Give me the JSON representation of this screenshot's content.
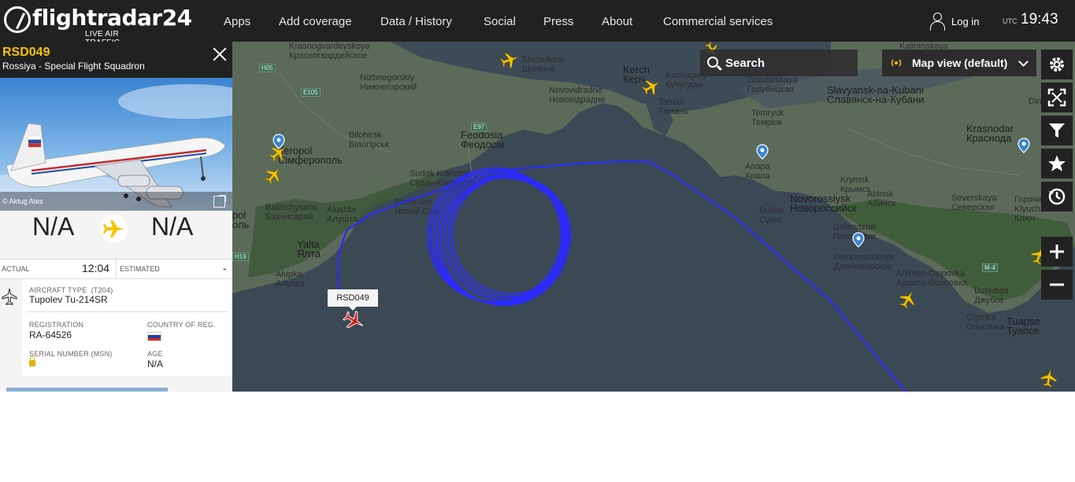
{
  "app": {
    "logo_text": "flightradar24",
    "logo_sub": "LIVE AIR TRAFFIC"
  },
  "nav": {
    "items": [
      "Apps",
      "Add coverage",
      "Data / History",
      "Social",
      "Press",
      "About",
      "Commercial services"
    ],
    "login": "Log in",
    "utc_label": "UTC",
    "clock": "19:43"
  },
  "flight": {
    "callsign": "RSD049",
    "airline": "Rossiya - Special Flight Squadron",
    "photo_credit": "© Aktug Ates",
    "origin": "N/A",
    "destination": "N/A",
    "actual_label": "ACTUAL",
    "actual_time": "12:04",
    "estimated_label": "ESTIMATED",
    "estimated_time": "-",
    "aircraft_type_label": "AIRCRAFT TYPE",
    "aircraft_type_code": "(T204)",
    "aircraft_type": "Tupolev Tu-214SR",
    "registration_label": "REGISTRATION",
    "registration": "RA-64526",
    "country_label": "COUNTRY OF REG.",
    "serial_label": "SERIAL NUMBER (MSN)",
    "age_label": "AGE",
    "age": "N/A",
    "map_label": "RSD049"
  },
  "map": {
    "search_label": "Search",
    "view_label": "Map view (default)",
    "labels": {
      "krasnogvardeyskoye": "Krasnogvardeyskoye",
      "krasnogvardeyskoye_ru": "Красногвардейское",
      "nizhnegorskiy": "Nizhnegorskiy",
      "nizhnegorskiy_ru": "Нижнегорский",
      "bilohirsk": "Bilohirsk",
      "bilohirsk_ru": "Білогірськ",
      "simferopol": "ıferopol",
      "simferopol_ru": "Сімферополь",
      "bakhchysarai": "Bakhchysarai",
      "bakhchysarai_ru": "Бахчисарай",
      "sevastopol": "pol",
      "sevastopol_ru": "оль",
      "alushta": "Alushta",
      "alushta_ru": "Алушта",
      "yalta": "Yalta",
      "yalta_ru": "Ялта",
      "alupka": "Alupka",
      "alupka_ru": "Алупка",
      "sudak": "Sudak Koktebel",
      "sudak_ru": "Судак-Коктебель",
      "noviy_svit": "Noviy Svit",
      "noviy_svit_ru": "Новий Світ",
      "feodosia": "Feodosia",
      "feodosia_ru": "Феодосія",
      "shcholkine": "Shcholkine",
      "shcholkine_ru": "Щолкіне",
      "novovidradne": "Novovidradne",
      "novovidradne_ru": "Нововідрадне",
      "nizhnegorskiy2": "Nizhnegorskiy",
      "kerch": "Kerch",
      "kerch_ru": "Керч",
      "kuchugury": "Kuchugury",
      "kuchugury_ru": "Кучугуры",
      "taman": "Taman",
      "taman_ru": "Тамань",
      "golubitskaya": "Golubitskaya",
      "golubitskaya_ru": "Голубицкая",
      "temryuk": "Temryuk",
      "temryuk_ru": "Темрюк",
      "anapa": "Anapa",
      "anapa_ru": "Анапа",
      "sukko": "Sukko",
      "sukko_ru": "Сукко",
      "novorossiysk": "Novorossiysk",
      "novorossiysk_ru": "Новороссийск",
      "krymsk": "Krymsk",
      "krymsk_ru": "Крымск",
      "abinsk": "Abinsk",
      "abinsk_ru": "Абинск",
      "gelendzhik": "Gelendzhik",
      "gelendzhik_ru": "Геленджик",
      "divnomorskoye": "Divnomorskoye",
      "divnomorskoye_ru": "Дивноморское",
      "slavyansk": "Slavyansk-na-Kubani",
      "slavyansk_ru": "Славянск-на-Кубани",
      "krasnodar": "Krasnodar",
      "krasnodar_ru": "Краснода",
      "kalininskaya": "Kalininskaya",
      "dinska": "Dinska",
      "severskaya": "Severskaya",
      "severskaya_ru": "Северская",
      "goryachiy": "Горячий",
      "klyuch": "Klyuch",
      "klyuch_ru": "Ключ",
      "arkhipo": "Arkhipo-Osipovka",
      "arkhipo_ru": "Архипо-Осиповка",
      "dzhubga": "Dzhubga",
      "dzhubga_ru": "Джубга",
      "olginka": "Olginka",
      "olginka_ru": "Ольгинка",
      "tuapse": "Tuapse",
      "tuapse_ru": "Туапсе",
      "novyi_svit2": "Noviy Svit"
    },
    "roads": [
      "H05",
      "E105",
      "E97",
      "H19",
      "M-4"
    ],
    "controls": [
      "settings",
      "fullscreen",
      "filter",
      "favorites",
      "playback",
      "zoom-in",
      "zoom-out"
    ]
  },
  "colors": {
    "accent": "#f7c500",
    "track": "#2b2bff",
    "topbar": "#212121",
    "plane_selected": "#cc2222",
    "plane": "#f7c500"
  }
}
